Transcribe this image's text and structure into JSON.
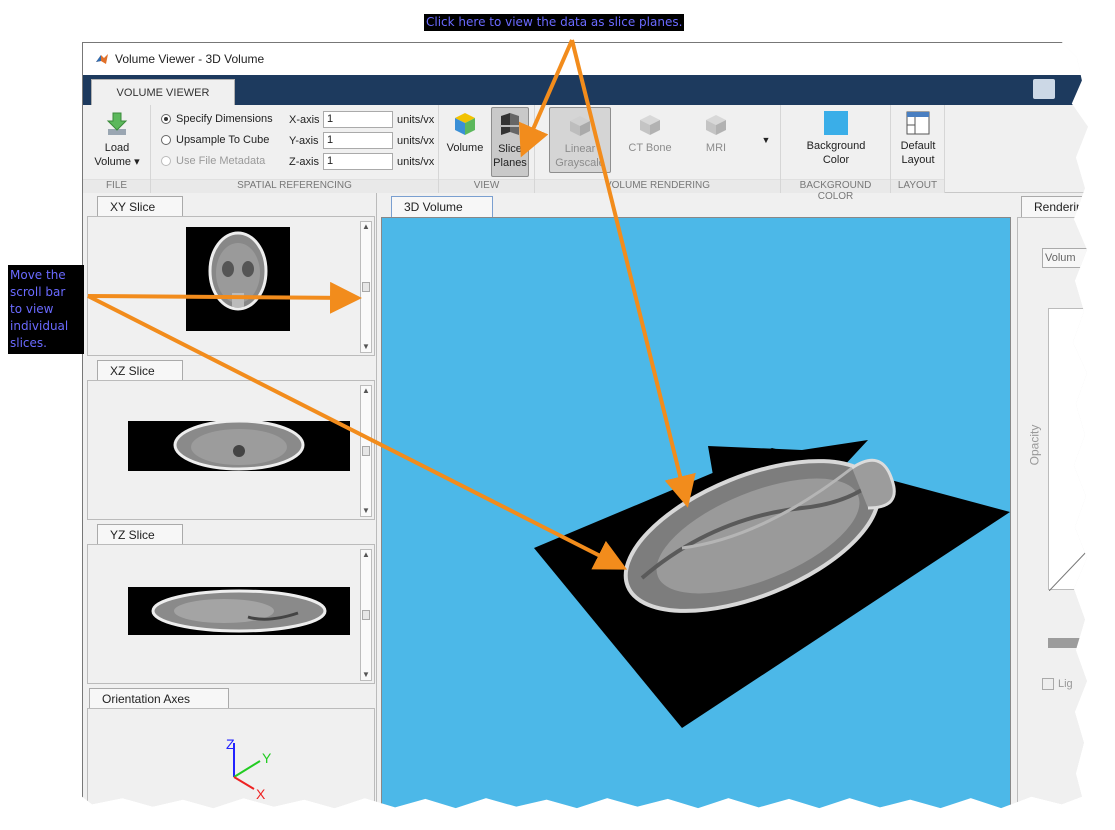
{
  "window": {
    "title": "Volume Viewer - 3D Volume"
  },
  "ribbon": {
    "tab_label": "VOLUME VIEWER",
    "file": {
      "group_label": "FILE",
      "load_line1": "Load",
      "load_line2": "Volume"
    },
    "spatial": {
      "group_label": "SPATIAL REFERENCING",
      "specify": "Specify Dimensions",
      "upsample": "Upsample To Cube",
      "metadata": "Use File Metadata",
      "x_label": "X-axis",
      "x_value": "1",
      "y_label": "Y-axis",
      "y_value": "1",
      "z_label": "Z-axis",
      "z_value": "1",
      "unit": "units/vx"
    },
    "view": {
      "group_label": "VIEW",
      "volume": "Volume",
      "slice_line1": "Slice",
      "slice_line2": "Planes"
    },
    "rendering": {
      "group_label": "VOLUME RENDERING",
      "linear_line1": "Linear",
      "linear_line2": "Grayscale",
      "ct_bone": "CT Bone",
      "mri": "MRI"
    },
    "background": {
      "group_label": "BACKGROUND COLOR",
      "line1": "Background",
      "line2": "Color"
    },
    "layout": {
      "group_label": "LAYOUT",
      "line1": "Default",
      "line2": "Layout"
    }
  },
  "panels": {
    "xy": "XY Slice",
    "xz": "XZ Slice",
    "yz": "YZ Slice",
    "orientation": "Orientation Axes",
    "center_tab": "3D Volume",
    "right_tab": "Rendering",
    "right_dropdown": "Volum",
    "right_axis_label": "Opacity",
    "right_checkbox": "Lig"
  },
  "axes_labels": {
    "z": "Z",
    "y": "Y",
    "x": "X"
  },
  "callouts": {
    "top": "Click here to view the data as slice planes.",
    "left_line1": "Move the",
    "left_line2": "scroll bar",
    "left_line3": "to view",
    "left_line4": "individual",
    "left_line5": "slices."
  },
  "colors": {
    "viewport": "#4cb8e8",
    "arrow": "#f28c1c",
    "ribbon_dark": "#1d3a5e",
    "background_swatch": "#3aaee8"
  }
}
